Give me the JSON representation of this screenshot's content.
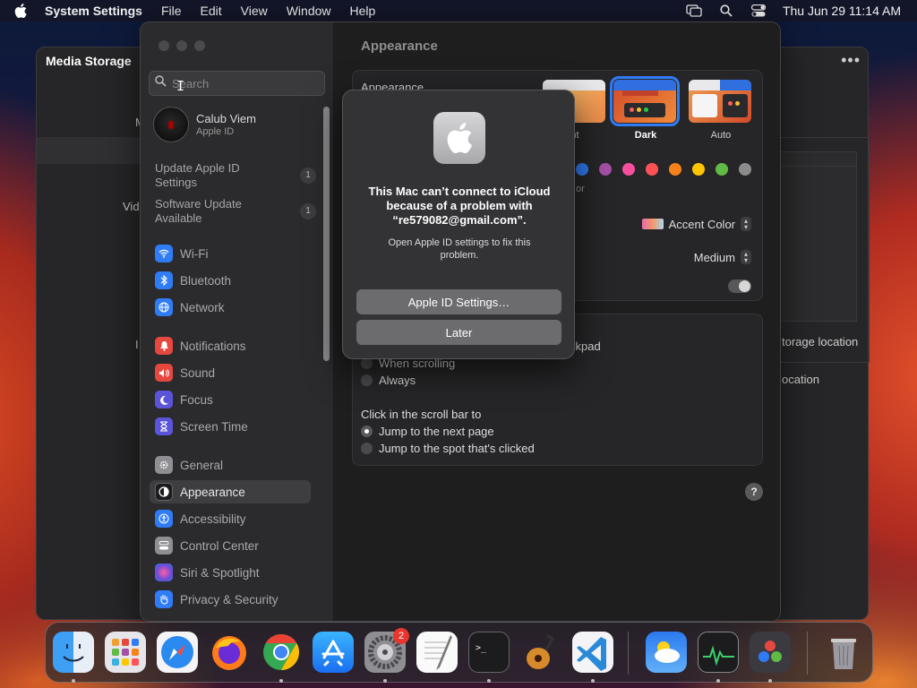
{
  "menubar": {
    "app_name": "System Settings",
    "items": [
      "File",
      "Edit",
      "View",
      "Window",
      "Help"
    ],
    "datetime": "Thu Jun 29  11:14 AM"
  },
  "background_window": {
    "title": "Media Storage",
    "fragments": {
      "m": "M",
      "vid": "Vid",
      "i": "I",
      "storage_location": "torage location",
      "ocation": "ocation"
    }
  },
  "sidebar": {
    "search_placeholder": "Search",
    "account": {
      "name": "Calub Viem",
      "subtitle": "Apple ID"
    },
    "notices": [
      {
        "label": "Update Apple ID Settings",
        "count": "1"
      },
      {
        "label": "Software Update Available",
        "count": "1"
      }
    ],
    "items": [
      {
        "label": "Wi-Fi",
        "icon": "wifi-icon",
        "color": "#2f7cf6"
      },
      {
        "label": "Bluetooth",
        "icon": "bluetooth-icon",
        "color": "#2f7cf6"
      },
      {
        "label": "Network",
        "icon": "globe-icon",
        "color": "#2f7cf6"
      },
      {
        "label": "Notifications",
        "icon": "bell-icon",
        "color": "#e5483f"
      },
      {
        "label": "Sound",
        "icon": "speaker-icon",
        "color": "#e5483f"
      },
      {
        "label": "Focus",
        "icon": "moon-icon",
        "color": "#5b54d8"
      },
      {
        "label": "Screen Time",
        "icon": "hourglass-icon",
        "color": "#5b54d8"
      },
      {
        "label": "General",
        "icon": "gear-icon",
        "color": "#8e8e93"
      },
      {
        "label": "Appearance",
        "icon": "appearance-icon",
        "color": "#1c1c1e"
      },
      {
        "label": "Accessibility",
        "icon": "accessibility-icon",
        "color": "#2f7cf6"
      },
      {
        "label": "Control Center",
        "icon": "control-center-icon",
        "color": "#8e8e93"
      },
      {
        "label": "Siri & Spotlight",
        "icon": "siri-icon",
        "color": "#c04fd6"
      },
      {
        "label": "Privacy & Security",
        "icon": "hand-icon",
        "color": "#2f7cf6"
      }
    ],
    "selected": "Appearance"
  },
  "content": {
    "title": "Appearance",
    "appearance_label": "Appearance",
    "themes": [
      {
        "label": "ht",
        "selected": false
      },
      {
        "label": "Dark",
        "selected": true
      },
      {
        "label": "Auto",
        "selected": false
      }
    ],
    "accent_colors": [
      "#2f7cf6",
      "#a550a7",
      "#f74f9e",
      "#ff5257",
      "#f7821b",
      "#ffc600",
      "#62ba46",
      "#8c8c8c"
    ],
    "or_fragment": "or",
    "highlight_label": "Accent Color",
    "sidebar_icon_size": "Medium",
    "trackpad_fragment": "ckpad",
    "scroll_options": [
      "When scrolling",
      "Always"
    ],
    "click_label": "Click in the scroll bar to",
    "click_options": [
      "Jump to the next page",
      "Jump to the spot that's clicked"
    ],
    "help": "?"
  },
  "alert": {
    "heading": "This Mac can’t connect to iCloud because of a problem with “re579082@gmail.com”.",
    "body": "Open Apple ID settings to fix this problem.",
    "primary_button": "Apple ID Settings…",
    "secondary_button": "Later"
  },
  "dock": {
    "apps": [
      {
        "name": "Finder",
        "icon": "finder-icon"
      },
      {
        "name": "Launchpad",
        "icon": "launchpad-icon"
      },
      {
        "name": "Safari",
        "icon": "safari-icon"
      },
      {
        "name": "Firefox",
        "icon": "firefox-icon"
      },
      {
        "name": "Chrome",
        "icon": "chrome-icon"
      },
      {
        "name": "App Store",
        "icon": "app-store-icon"
      },
      {
        "name": "System Settings",
        "icon": "system-settings-icon",
        "badge": "2"
      },
      {
        "name": "TextEdit",
        "icon": "textedit-icon"
      },
      {
        "name": "Terminal",
        "icon": "terminal-icon"
      },
      {
        "name": "GarageBand",
        "icon": "garageband-icon"
      },
      {
        "name": "Visual Studio Code",
        "icon": "vscode-icon"
      },
      {
        "name": "Weather",
        "icon": "weather-icon"
      },
      {
        "name": "Activity Monitor",
        "icon": "activity-monitor-icon"
      },
      {
        "name": "DaVinci Resolve",
        "icon": "davinci-icon"
      },
      {
        "name": "Trash",
        "icon": "trash-icon"
      }
    ]
  }
}
